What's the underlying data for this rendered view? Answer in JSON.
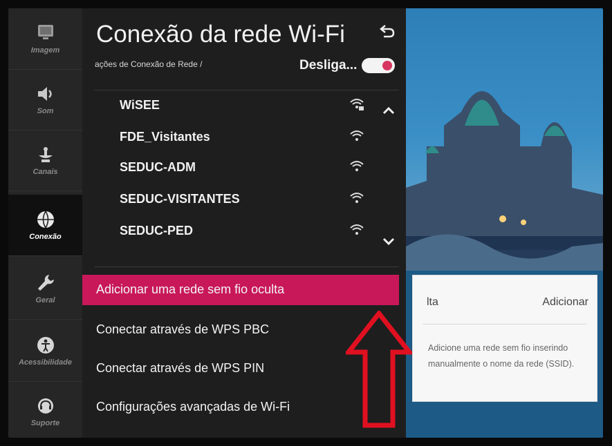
{
  "sidebar": {
    "items": [
      {
        "label": "Imagem",
        "icon": "picture-icon"
      },
      {
        "label": "Som",
        "icon": "speaker-icon"
      },
      {
        "label": "Canais",
        "icon": "antenna-icon"
      },
      {
        "label": "Conexão",
        "icon": "globe-icon"
      },
      {
        "label": "Geral",
        "icon": "wrench-icon"
      },
      {
        "label": "Acessibilidade",
        "icon": "accessibility-icon"
      },
      {
        "label": "Suporte",
        "icon": "headset-icon"
      }
    ],
    "active": "Conexão"
  },
  "panel": {
    "title": "Conexão da rede Wi-Fi",
    "breadcrumb": "ações de Conexão de Rede /",
    "toggle_label": "Desliga...",
    "networks": [
      {
        "name": "WiSEE",
        "secured": true
      },
      {
        "name": "FDE_Visitantes",
        "secured": false
      },
      {
        "name": "SEDUC-ADM",
        "secured": false
      },
      {
        "name": "SEDUC-VISITANTES",
        "secured": false
      },
      {
        "name": "SEDUC-PED",
        "secured": false
      }
    ],
    "options": [
      {
        "label": "Adicionar uma rede sem fio oculta",
        "selected": true
      },
      {
        "label": "Conectar através de WPS PBC",
        "selected": false
      },
      {
        "label": "Conectar através de WPS PIN",
        "selected": false
      },
      {
        "label": "Configurações avançadas de Wi-Fi",
        "selected": false
      }
    ]
  },
  "tooltip": {
    "title": "lta",
    "action": "Adicionar",
    "body": "Adicione uma rede sem fio inserindo manualmente o nome da rede (SSID)."
  },
  "colors": {
    "accent": "#c8185a",
    "toggle_knob": "#d6365f",
    "arrow": "#e01020"
  }
}
